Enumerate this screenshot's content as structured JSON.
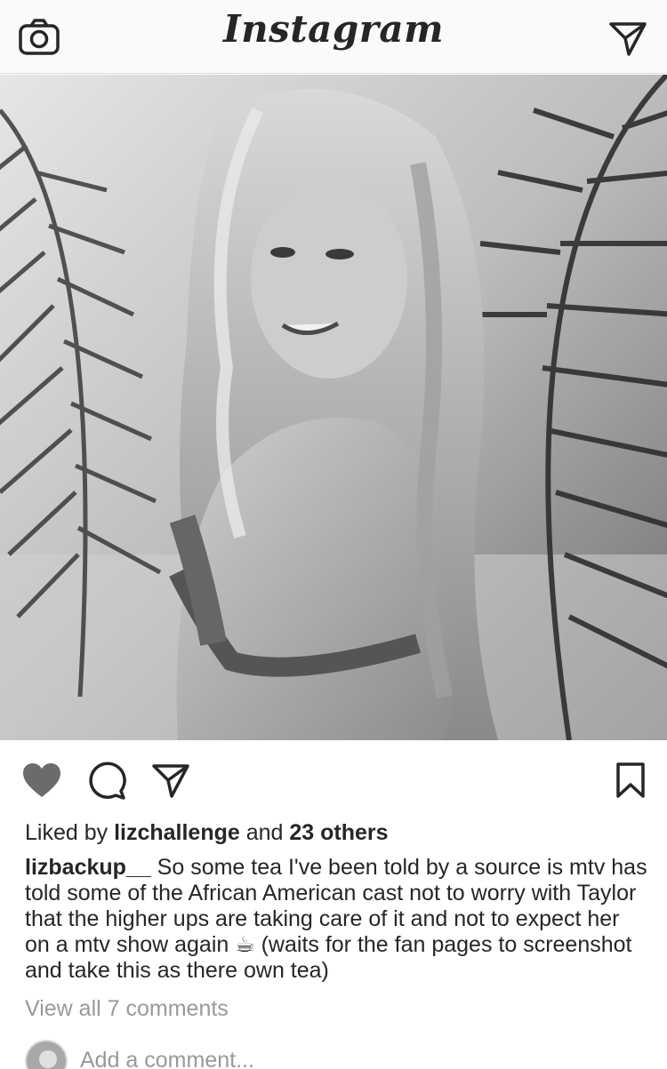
{
  "header": {
    "logo_text": "Instagram",
    "left_icon": "camera-icon",
    "right_icon": "direct-message-icon"
  },
  "post": {
    "image_description_icon": "post-photo",
    "actions": {
      "like_icon": "heart-icon",
      "comment_icon": "comment-icon",
      "share_icon": "share-icon",
      "save_icon": "bookmark-icon",
      "liked": true
    },
    "likes": {
      "prefix": "Liked by ",
      "user": "lizchallenge",
      "middle": " and ",
      "others": "23 others"
    },
    "caption": {
      "username": "lizbackup__",
      "text": " So some tea I've been told by a source is mtv has told some of the African American cast not to worry with Taylor that the higher ups are taking care of it and not to expect her on a mtv show again ☕ (waits for the fan pages to screenshot and take this as there own tea)"
    },
    "view_comments": "View all 7 comments",
    "add_comment_placeholder": "Add a comment..."
  },
  "colors": {
    "text": "#262626",
    "muted": "#999999",
    "header_bg": "#fafafa",
    "border": "#dbdbdb"
  }
}
